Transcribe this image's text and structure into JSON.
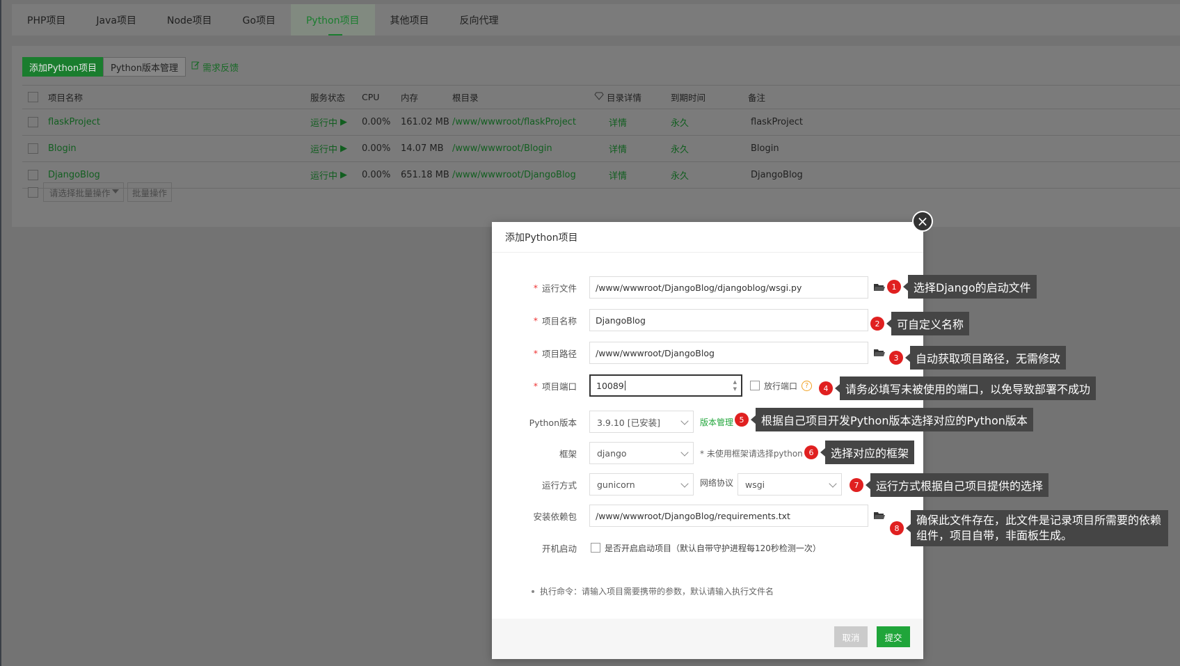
{
  "tabs": [
    {
      "label": "PHP项目",
      "active": false
    },
    {
      "label": "Java项目",
      "active": false
    },
    {
      "label": "Node项目",
      "active": false
    },
    {
      "label": "Go项目",
      "active": false
    },
    {
      "label": "Python项目",
      "active": true
    },
    {
      "label": "其他项目",
      "active": false
    },
    {
      "label": "反向代理",
      "active": false
    }
  ],
  "toolbar": {
    "add_label": "添加Python项目",
    "version_label": "Python版本管理",
    "feedback_label": "需求反馈"
  },
  "table": {
    "headers": {
      "name": "项目名称",
      "status": "服务状态",
      "cpu": "CPU",
      "memory": "内存",
      "root": "根目录",
      "detail": "目录详情",
      "expire": "到期时间",
      "remark": "备注"
    },
    "rows": [
      {
        "name": "flaskProject",
        "status": "运行中",
        "cpu": "0.00%",
        "memory": "161.02 MB",
        "root": "/www/wwwroot/flaskProject",
        "detail": "详情",
        "expire": "永久",
        "remark": "flaskProject"
      },
      {
        "name": "Blogin",
        "status": "运行中",
        "cpu": "0.00%",
        "memory": "14.07 MB",
        "root": "/www/wwwroot/Blogin",
        "detail": "详情",
        "expire": "永久",
        "remark": "Blogin"
      },
      {
        "name": "DjangoBlog",
        "status": "运行中",
        "cpu": "0.00%",
        "memory": "651.18 MB",
        "root": "/www/wwwroot/DjangoBlog",
        "detail": "详情",
        "expire": "永久",
        "remark": "DjangoBlog"
      }
    ],
    "batch_placeholder": "请选择批量操作",
    "batch_button": "批量操作"
  },
  "modal": {
    "title": "添加Python项目",
    "fields": {
      "run_file_label": "运行文件",
      "run_file_value": "/www/wwwroot/DjangoBlog/djangoblog/wsgi.py",
      "name_label": "项目名称",
      "name_value": "DjangoBlog",
      "path_label": "项目路径",
      "path_value": "/www/wwwroot/DjangoBlog",
      "port_label": "项目端口",
      "port_value": "10089",
      "open_port_label": "放行端口",
      "python_version_label": "Python版本",
      "python_version_value": "3.9.10 [已安装]",
      "version_manage_link": "版本管理",
      "framework_label": "框架",
      "framework_value": "django",
      "framework_hint": "* 未使用框架请选择python",
      "run_mode_label": "运行方式",
      "run_mode_value": "gunicorn",
      "protocol_label": "网络协议",
      "protocol_value": "wsgi",
      "deps_label": "安装依赖包",
      "deps_value": "/www/wwwroot/DjangoBlog/requirements.txt",
      "autostart_label": "开机启动",
      "autostart_text": "是否开启启动项目（默认自带守护进程每120秒检测一次）"
    },
    "note": "执行命令：请输入项目需要携带的参数，默认请输入执行文件名",
    "cancel_label": "取消",
    "submit_label": "提交"
  },
  "annotations": [
    {
      "num": "1",
      "text": "选择Django的启动文件"
    },
    {
      "num": "2",
      "text": "可自定义名称"
    },
    {
      "num": "3",
      "text": "自动获取项目路径，无需修改"
    },
    {
      "num": "4",
      "text": "请务必填写未被使用的端口，以免导致部署不成功"
    },
    {
      "num": "5",
      "text": "根据自己项目开发Python版本选择对应的Python版本"
    },
    {
      "num": "6",
      "text": "选择对应的框架"
    },
    {
      "num": "7",
      "text": "运行方式根据自己项目提供的选择"
    },
    {
      "num": "8",
      "text": "确保此文件存在，此文件是记录项目所需要的依赖组件，项目自带，非面板生成。"
    }
  ],
  "colors": {
    "brand_green": "#20a53a",
    "annotation_badge": "#e02020",
    "annotation_box": "#454545"
  }
}
